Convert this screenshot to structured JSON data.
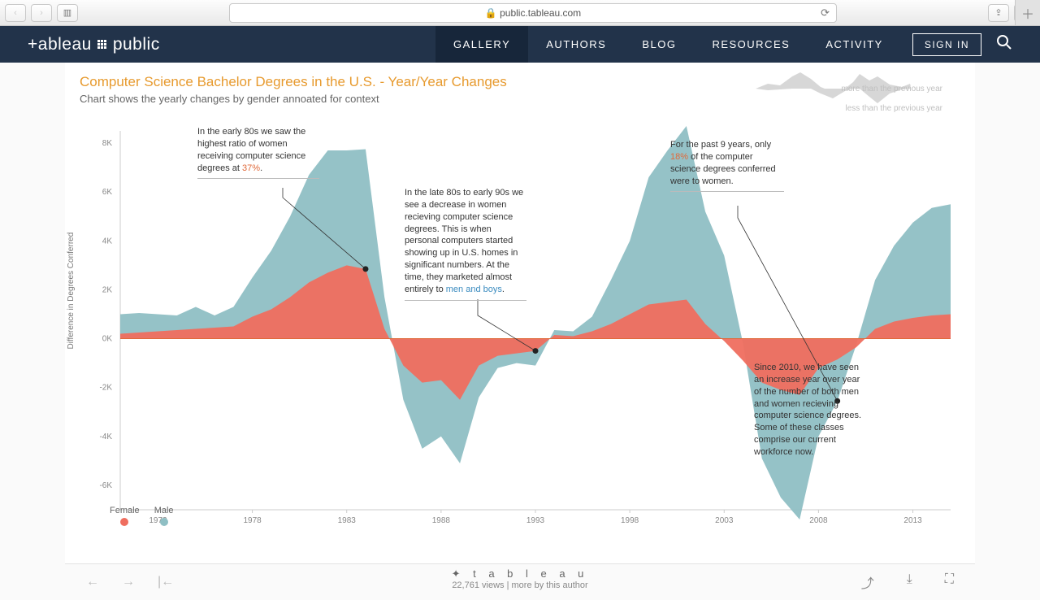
{
  "browser": {
    "url_host": "public.tableau.com",
    "lock": "🔒"
  },
  "nav": {
    "brand_left": "+ableau",
    "brand_right": "public",
    "items": [
      "GALLERY",
      "AUTHORS",
      "BLOG",
      "RESOURCES",
      "ACTIVITY"
    ],
    "active": 0,
    "signin": "SIGN IN"
  },
  "viz": {
    "title": "Computer Science Bachelor Degrees in the U.S. - Year/Year Changes",
    "subtitle": "Chart shows the yearly changes by gender annoated for context",
    "ylabel": "Difference in Degrees Conferred",
    "legend": {
      "female": "Female",
      "male": "Male"
    },
    "mini_top": "more than the previous year",
    "mini_bot": "less than the previous year"
  },
  "annotations": {
    "a1": {
      "text_pre": "In the early 80s we saw the highest ratio of women receiving computer science degrees at ",
      "hl": "37%",
      "text_post": "."
    },
    "a2": {
      "text_pre": "In the late 80s to early 90s we see a decrease in women recieving computer science degrees. This is when personal computers started showing up in U.S. homes in significant numbers. At the time, they marketed almost entirely to ",
      "hl": "men and boys",
      "text_post": "."
    },
    "a3": {
      "text_pre": "For the past 9 years, only ",
      "hl": "18%",
      "text_post": " of the computer science degrees conferred were to women."
    },
    "a4": {
      "text": "Since 2010, we have seen an increase year over year of the number of both men and women recieving computer science degrees. Some of these classes comprise our current workforce now."
    }
  },
  "footer": {
    "views": "22,761 views",
    "sep": "  |  ",
    "more": "more by this author",
    "tableau_word": "t a b l e a u"
  },
  "chart_data": {
    "type": "area",
    "title": "Computer Science Bachelor Degrees in the U.S. - Year/Year Changes",
    "xlabel": "",
    "ylabel": "Difference in Degrees Conferred",
    "ylim": [
      -7000,
      8500
    ],
    "y_ticks": [
      -6000,
      -4000,
      -2000,
      0,
      2000,
      4000,
      6000,
      8000
    ],
    "y_tick_labels": [
      "-6K",
      "-4K",
      "-2K",
      "0K",
      "2K",
      "4K",
      "6K",
      "8K"
    ],
    "x": [
      1971,
      1972,
      1973,
      1974,
      1975,
      1976,
      1977,
      1978,
      1979,
      1980,
      1981,
      1982,
      1983,
      1984,
      1985,
      1986,
      1987,
      1988,
      1989,
      1990,
      1991,
      1992,
      1993,
      1994,
      1995,
      1996,
      1997,
      1998,
      1999,
      2000,
      2001,
      2002,
      2003,
      2004,
      2005,
      2006,
      2007,
      2008,
      2009,
      2010,
      2011,
      2012,
      2013,
      2014,
      2015
    ],
    "x_ticks": [
      1973,
      1978,
      1983,
      1988,
      1993,
      1998,
      2003,
      2008,
      2013
    ],
    "series": [
      {
        "name": "Male",
        "color": "#8fbfc4",
        "values": [
          800,
          800,
          700,
          600,
          900,
          500,
          800,
          1600,
          2400,
          3300,
          4400,
          5000,
          4700,
          4900,
          1300,
          -1400,
          -2700,
          -2300,
          -2600,
          -1300,
          -500,
          -400,
          -600,
          200,
          200,
          600,
          1800,
          3000,
          5200,
          6200,
          7100,
          4600,
          3500,
          700,
          -3100,
          -4400,
          -5100,
          -2800,
          -1700,
          100,
          2000,
          3100,
          3900,
          4400,
          4500
        ]
      },
      {
        "name": "Female",
        "color": "#ef6e5f",
        "values": [
          200,
          250,
          300,
          350,
          400,
          450,
          500,
          900,
          1200,
          1700,
          2300,
          2700,
          3000,
          2850,
          400,
          -1100,
          -1800,
          -1700,
          -2500,
          -1100,
          -700,
          -600,
          -500,
          150,
          100,
          300,
          600,
          1000,
          1400,
          1500,
          1600,
          600,
          -100,
          -900,
          -1800,
          -2100,
          -2300,
          -1200,
          -850,
          -350,
          400,
          700,
          850,
          950,
          1000
        ]
      }
    ]
  }
}
